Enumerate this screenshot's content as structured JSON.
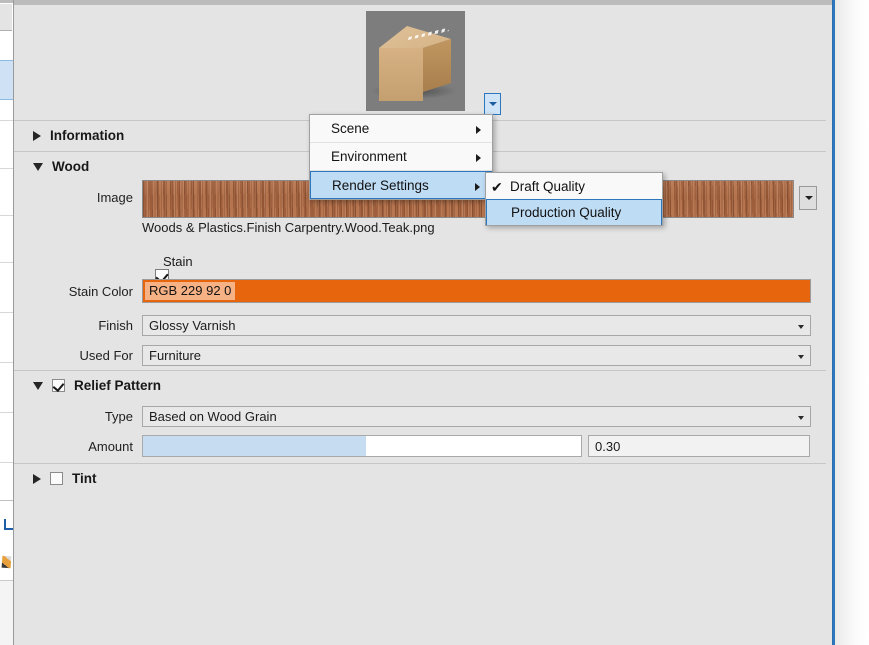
{
  "window": {
    "title_bar_color": "#bcbcbc",
    "accent_border": "#2e77bd"
  },
  "preview": {
    "name": "material-preview-thumbnail",
    "dropdown_icon": "chevron-down-icon",
    "background_color": "#7d7d7d",
    "object": "cardboard-box"
  },
  "sections": [
    {
      "label": "Information",
      "expanded": false,
      "has_checkbox": false
    },
    {
      "label": "Wood",
      "expanded": true,
      "has_checkbox": false
    },
    {
      "label": "Relief  Pattern",
      "expanded": true,
      "has_checkbox": true,
      "checked": true
    },
    {
      "label": "Tint",
      "expanded": false,
      "has_checkbox": true,
      "checked": false
    }
  ],
  "wood": {
    "image_label": "Image",
    "image_path": "Woods & Plastics.Finish Carpentry.Wood.Teak.png",
    "image_dropdown_icon": "chevron-down-icon",
    "stain_checkbox_label": "Stain",
    "stain_checked": true,
    "stain_color_label": "Stain Color",
    "stain_color_value": "RGB 229 92 0",
    "stain_color_hex": "#e6650d",
    "finish_label": "Finish",
    "finish_value": "Glossy Varnish",
    "used_for_label": "Used For",
    "used_for_value": "Furniture"
  },
  "relief": {
    "type_label": "Type",
    "type_value": "Based on Wood Grain",
    "amount_label": "Amount",
    "amount_value": "0.30",
    "amount_fill_percent": 51,
    "slider_fill_hex": "#c6dcf1"
  },
  "context_menu": {
    "items": [
      {
        "label": "Scene",
        "has_submenu": true,
        "highlighted": false
      },
      {
        "label": "Environment",
        "has_submenu": true,
        "highlighted": false
      },
      {
        "label": "Render Settings",
        "has_submenu": true,
        "highlighted": true
      }
    ],
    "submenu": {
      "items": [
        {
          "label": "Draft Quality",
          "checked": true,
          "highlighted": false
        },
        {
          "label": "Production Quality",
          "checked": false,
          "highlighted": true
        }
      ],
      "check_glyph": "✔"
    }
  }
}
